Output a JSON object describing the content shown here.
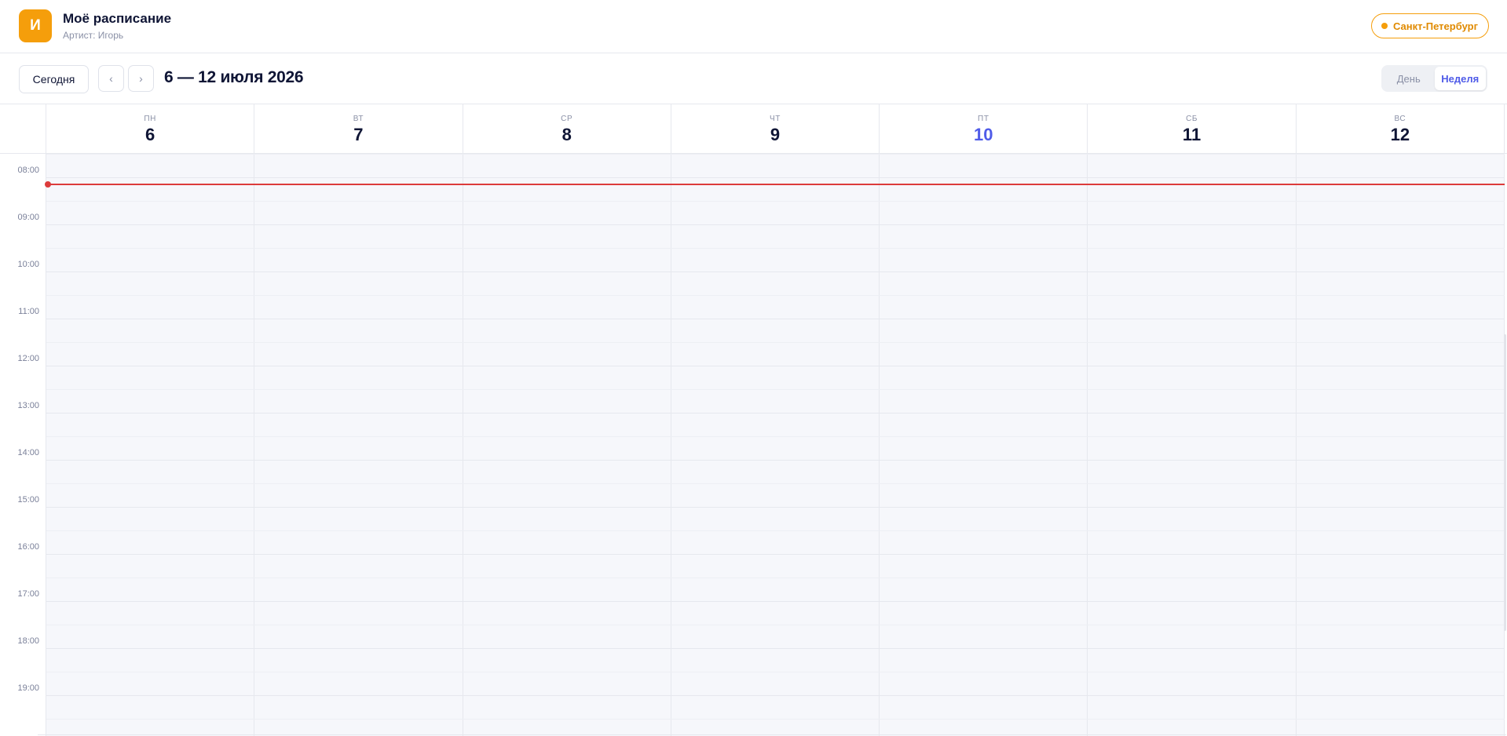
{
  "header": {
    "avatar_letter": "И",
    "title": "Моё расписание",
    "subtitle": "Артист: Игорь",
    "city": "Санкт-Петербург",
    "accent_color": "#f59e0b"
  },
  "toolbar": {
    "today_label": "Сегодня",
    "prev_label": "‹",
    "next_label": "›",
    "range_title": "6 — 12 июля 2026",
    "view_day_label": "День",
    "view_week_label": "Неделя",
    "active_view": "week"
  },
  "days": [
    {
      "dow": "ПН",
      "num": "6",
      "today": false
    },
    {
      "dow": "ВТ",
      "num": "7",
      "today": false
    },
    {
      "dow": "СР",
      "num": "8",
      "today": false
    },
    {
      "dow": "ЧТ",
      "num": "9",
      "today": false
    },
    {
      "dow": "ПТ",
      "num": "10",
      "today": true
    },
    {
      "dow": "СБ",
      "num": "11",
      "today": false
    },
    {
      "dow": "ВС",
      "num": "12",
      "today": false
    }
  ],
  "times": [
    "08:00",
    "09:00",
    "10:00",
    "11:00",
    "12:00",
    "13:00",
    "14:00",
    "15:00",
    "16:00",
    "17:00",
    "18:00",
    "19:00"
  ],
  "colors": {
    "today": "#4f5be8",
    "now_indicator": "#dc3b3b"
  }
}
